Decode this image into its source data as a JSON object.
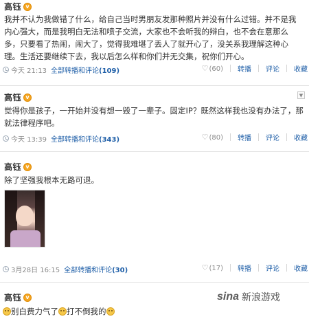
{
  "posts": [
    {
      "author": "高钰",
      "verified_badge": "v",
      "text": "我并不认为我做错了什么，给自己当时男朋友发那种照片并没有什么过错。并不是我内心强大，而是我明白无法和喷子交流，大家也不会听我的辩白，也不会在意那么多，只要看了热闹，闹大了，觉得我难堪了丢人了就开心了，没关系我理解这种心理。生活还要继续下去，我以后怎么样和你们并无交集，祝你们开心。",
      "time": "今天 21:13",
      "repost_label": "全部转播和评论",
      "repost_count": "(109)",
      "likes": "(60)",
      "actions": [
        "转播",
        "评论",
        "收藏"
      ]
    },
    {
      "author": "高钰",
      "verified_badge": "v",
      "text": "觉得你是孩子，一开始并没有想一毁了一辈子。固定IP？既然这样我也没有办法了，那就法律程序吧。",
      "time": "今天 13:39",
      "repost_label": "全部转播和评论",
      "repost_count": "(343)",
      "likes": "(80)",
      "actions": [
        "转播",
        "评论",
        "收藏"
      ]
    },
    {
      "author": "高钰",
      "verified_badge": "v",
      "text": "除了坚强我根本无路可退。",
      "time": "3月28日 16:15",
      "repost_label": "全部转播和评论",
      "repost_count": "(30)",
      "likes": "(17)",
      "actions": [
        "转播",
        "评论",
        "收藏"
      ]
    },
    {
      "author": "高钰",
      "verified_badge": "v",
      "text_parts": [
        "别白费力气了",
        "打不倒我的"
      ]
    }
  ],
  "watermark": {
    "logo": "sina",
    "text": "新浪游戏"
  },
  "icons": {
    "time": "clock-icon",
    "like": "heart-icon",
    "menu": "chevron-down-icon",
    "emoji": "smiley-emoji-icon"
  }
}
